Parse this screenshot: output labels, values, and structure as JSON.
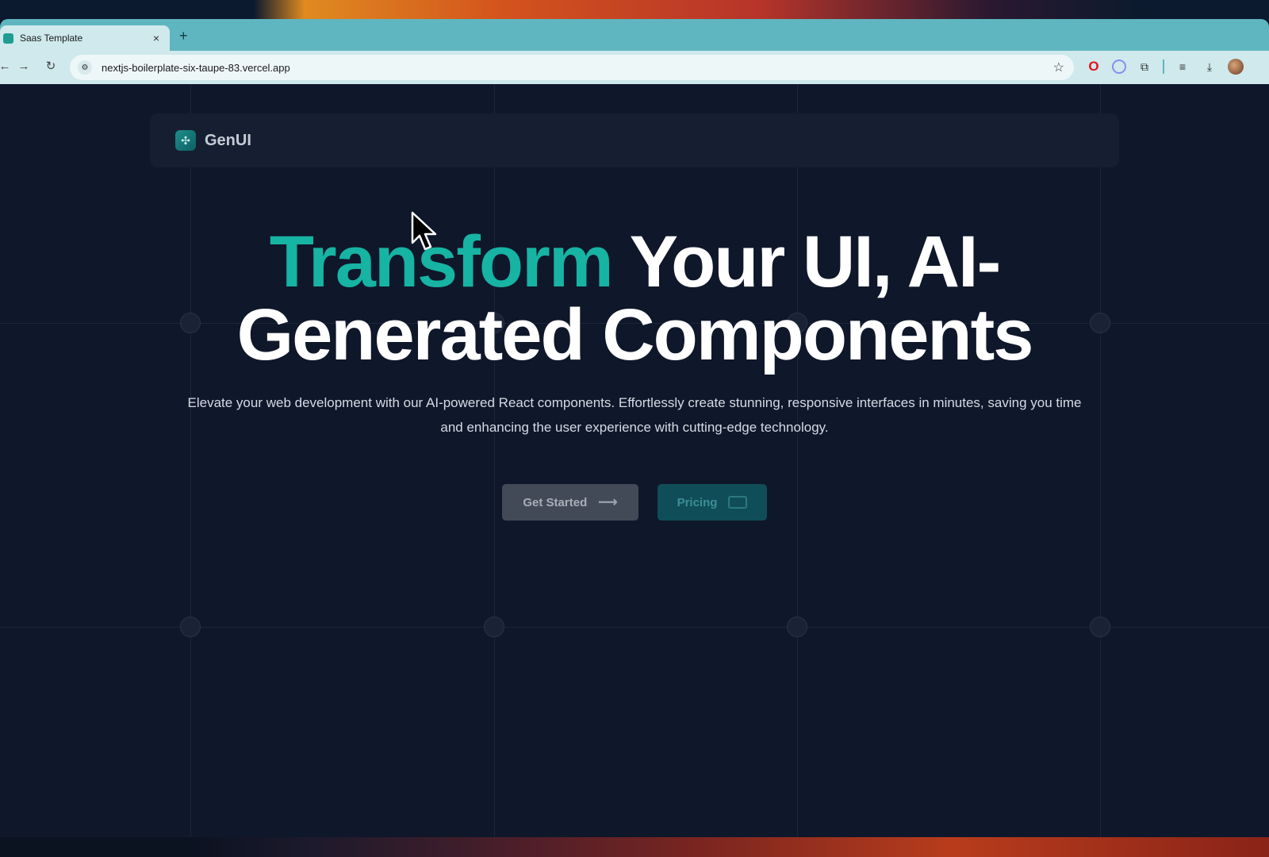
{
  "browser": {
    "tab_title": "Saas Template",
    "tab_close": "×",
    "new_tab": "+",
    "url": "nextjs-boilerplate-six-taupe-83.vercel.app"
  },
  "site": {
    "brand": "GenUI",
    "hero": {
      "title_accent": "Transform",
      "title_line1_rest": " Your UI, AI-",
      "title_line2": "Generated Components",
      "subtitle": "Elevate your web development with our AI-powered React components. Effortlessly create stunning, responsive interfaces in minutes, saving you time and enhancing the user experience with cutting-edge technology."
    },
    "buttons": {
      "get_started": "Get Started",
      "pricing": "Pricing"
    }
  },
  "colors": {
    "accent": "#17b3a3",
    "background": "#0f172a",
    "tab_strip": "#5fb6c0"
  }
}
